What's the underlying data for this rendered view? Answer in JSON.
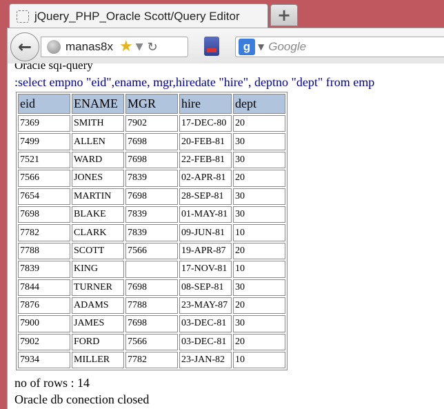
{
  "tab": {
    "title": "jQuery_PHP_Oracle Scott/Query Editor",
    "new_tab_label": "+"
  },
  "nav": {
    "url": "manas8x",
    "search_engine_letter": "g",
    "search_placeholder": "Google",
    "icons": {
      "back": "back-arrow-icon",
      "site": "globe-icon",
      "bookmark": "star-icon",
      "reload": "reload-icon"
    }
  },
  "page": {
    "heading": "Oracle sql-query",
    "query": ":select empno \"eid\",ename, mgr,hiredate \"hire\", deptno \"dept\" from emp",
    "columns": [
      "eid",
      "ENAME",
      "MGR",
      "hire",
      "dept"
    ],
    "rows": [
      [
        "7369",
        "SMITH",
        "7902",
        "17-DEC-80",
        "20"
      ],
      [
        "7499",
        "ALLEN",
        "7698",
        "20-FEB-81",
        "30"
      ],
      [
        "7521",
        "WARD",
        "7698",
        "22-FEB-81",
        "30"
      ],
      [
        "7566",
        "JONES",
        "7839",
        "02-APR-81",
        "20"
      ],
      [
        "7654",
        "MARTIN",
        "7698",
        "28-SEP-81",
        "30"
      ],
      [
        "7698",
        "BLAKE",
        "7839",
        "01-MAY-81",
        "30"
      ],
      [
        "7782",
        "CLARK",
        "7839",
        "09-JUN-81",
        "10"
      ],
      [
        "7788",
        "SCOTT",
        "7566",
        "19-APR-87",
        "20"
      ],
      [
        "7839",
        "KING",
        "",
        "17-NOV-81",
        "10"
      ],
      [
        "7844",
        "TURNER",
        "7698",
        "08-SEP-81",
        "30"
      ],
      [
        "7876",
        "ADAMS",
        "7788",
        "23-MAY-87",
        "20"
      ],
      [
        "7900",
        "JAMES",
        "7698",
        "03-DEC-81",
        "30"
      ],
      [
        "7902",
        "FORD",
        "7566",
        "03-DEC-81",
        "20"
      ],
      [
        "7934",
        "MILLER",
        "7782",
        "23-JAN-82",
        "10"
      ]
    ],
    "row_count_text": "no of rows : 14",
    "closed_text": "Oracle db conection closed"
  },
  "colors": {
    "frame": "#c0595f",
    "header_bg": "#b0c4de",
    "query_text": "#000099"
  }
}
